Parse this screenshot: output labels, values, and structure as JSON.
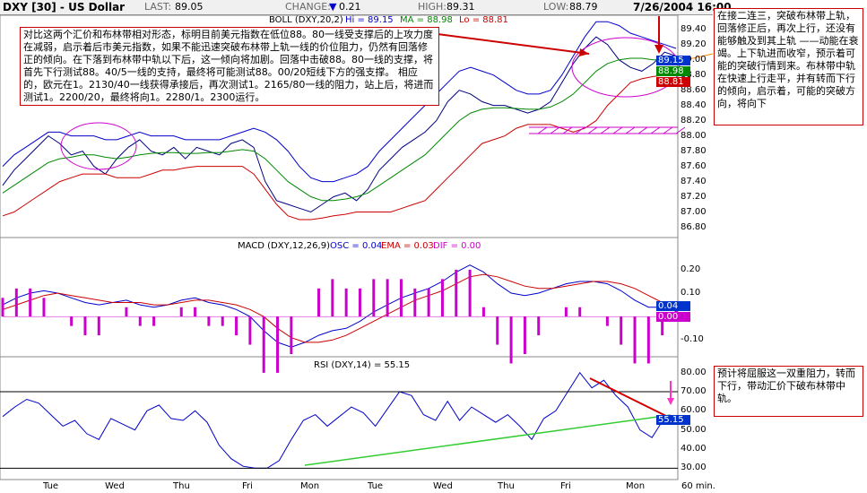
{
  "header": {
    "title": "DXY [30] - US Dollar",
    "last_label": "LAST:",
    "last": "89.05",
    "change_label": "CHANGE:",
    "change_arrow": "▼",
    "change": "0.21",
    "high_label": "HIGH:",
    "high": "89.31",
    "low_label": "LOW:",
    "low": "88.79",
    "datetime": "7/26/2004 16:00"
  },
  "price_panel": {
    "boll_title": "BOLL (DXY,20,2)",
    "boll_hi": "Hi = 89.15",
    "boll_ma": "MA = 88.98",
    "boll_lo": "Lo = 88.81",
    "tags": {
      "hi": "89.15",
      "ma": "88.98",
      "lo": "88.81"
    },
    "tag_colors": {
      "hi": "#0033cc",
      "ma": "#008800",
      "lo": "#cc0000"
    },
    "yticks": [
      "89.40",
      "89.20",
      "89.00",
      "88.80",
      "88.60",
      "88.40",
      "88.20",
      "88.00",
      "87.80",
      "87.60",
      "87.40",
      "87.20",
      "87.00",
      "86.80"
    ]
  },
  "macd_panel": {
    "title": "MACD (DXY,12,26,9)",
    "osc": "OSC = 0.04",
    "ema": "EMA = 0.03",
    "dif": "DIF = 0.00",
    "tag": "0.04",
    "tag2": "0.00",
    "yticks": [
      "0.20",
      "0.10",
      "-0.10"
    ]
  },
  "rsi_panel": {
    "title": "RSI (DXY,14) = 55.15",
    "tag": "55.15",
    "yticks": [
      "80.00",
      "70.00",
      "60.00",
      "50.00",
      "40.00",
      "30.00"
    ]
  },
  "xaxis": {
    "labels": [
      "Tue",
      "Wed",
      "Thu",
      "Fri",
      "Mon",
      "Tue",
      "Wed",
      "Thu",
      "Fri",
      "Mon"
    ],
    "unit": "60 min."
  },
  "annotations": {
    "left": "对比这两个汇价和布林带相对形态，标明目前美元指数在低位88。80一线受支撑后的上攻力度在减弱，启示着后市美元指数，如果不能迅速突破布林带上轨一线的价位阻力，仍然有回落修正的倾向。在下落到布林带中轨以下后，这一倾向将加剧。回落中击破88。80一线的支撑，将首先下行测试88。40/5一线的支持，最终将可能测试88。00/20短线下方的强支撑。 相应的，欧元在1。2130/40一线获得承接后，再次测试1。2165/80一线的阻力，站上后，将进而测试1。2200/20，最终将向1。2280/1。2300运行。",
    "right": "在接二连三，突破布林带上轨，回落修正后，再次上行，还没有能够触及到其上轨 ——动能在衰竭。上下轨进而收窄，预示着可能的突破行情到来。布林带中轨在快速上行走平，并有转而下行的倾向，启示着，可能的突破方向，将向下",
    "rsi": "预计将屈服这一双重阻力，转而下行，带动汇价下破布林带中轨。"
  },
  "chart_data": [
    {
      "type": "line",
      "title": "DXY [30] - US Dollar",
      "ylim": [
        86.7,
        89.55
      ],
      "series": [
        {
          "name": "Close",
          "color": "#000080",
          "values": [
            87.35,
            87.55,
            87.7,
            87.85,
            88.0,
            87.9,
            87.75,
            87.8,
            87.6,
            87.5,
            87.7,
            87.85,
            87.95,
            87.8,
            87.75,
            87.85,
            87.7,
            87.85,
            87.8,
            87.75,
            87.9,
            87.95,
            87.85,
            87.4,
            87.15,
            87.1,
            87.05,
            87.0,
            87.1,
            87.2,
            87.25,
            87.15,
            87.3,
            87.55,
            87.7,
            87.85,
            87.95,
            88.05,
            88.2,
            88.45,
            88.6,
            88.55,
            88.45,
            88.4,
            88.4,
            88.35,
            88.3,
            88.35,
            88.45,
            88.7,
            88.95,
            89.15,
            89.3,
            89.2,
            89.0,
            88.9,
            88.85,
            88.95,
            89.1,
            89.05
          ]
        },
        {
          "name": "BOLL Hi",
          "color": "#0000cc",
          "values": [
            87.6,
            87.75,
            87.85,
            87.95,
            88.05,
            88.05,
            88.0,
            88.0,
            88.0,
            87.95,
            87.95,
            88.0,
            88.05,
            88.0,
            88.0,
            88.0,
            87.95,
            87.95,
            87.95,
            87.95,
            88.0,
            88.05,
            88.1,
            88.05,
            87.95,
            87.8,
            87.6,
            87.45,
            87.4,
            87.4,
            87.45,
            87.5,
            87.6,
            87.8,
            87.95,
            88.1,
            88.25,
            88.4,
            88.55,
            88.7,
            88.85,
            88.9,
            88.85,
            88.8,
            88.7,
            88.6,
            88.55,
            88.55,
            88.6,
            88.8,
            89.05,
            89.3,
            89.5,
            89.5,
            89.45,
            89.35,
            89.3,
            89.25,
            89.2,
            89.15
          ]
        },
        {
          "name": "BOLL MA",
          "color": "#008800",
          "values": [
            87.25,
            87.35,
            87.45,
            87.55,
            87.65,
            87.7,
            87.72,
            87.75,
            87.75,
            87.72,
            87.7,
            87.72,
            87.75,
            87.77,
            87.78,
            87.78,
            87.77,
            87.77,
            87.78,
            87.78,
            87.8,
            87.82,
            87.8,
            87.7,
            87.55,
            87.4,
            87.3,
            87.2,
            87.15,
            87.15,
            87.17,
            87.2,
            87.25,
            87.35,
            87.45,
            87.55,
            87.65,
            87.75,
            87.9,
            88.05,
            88.2,
            88.3,
            88.35,
            88.37,
            88.37,
            88.36,
            88.35,
            88.35,
            88.38,
            88.45,
            88.55,
            88.7,
            88.85,
            88.95,
            89.0,
            89.02,
            89.02,
            89.0,
            89.0,
            88.98
          ]
        },
        {
          "name": "BOLL Lo",
          "color": "#cc0000",
          "values": [
            86.95,
            87.0,
            87.1,
            87.2,
            87.3,
            87.4,
            87.45,
            87.5,
            87.5,
            87.5,
            87.45,
            87.45,
            87.45,
            87.5,
            87.55,
            87.55,
            87.58,
            87.6,
            87.6,
            87.6,
            87.6,
            87.6,
            87.5,
            87.3,
            87.1,
            86.95,
            86.9,
            86.9,
            86.92,
            86.95,
            86.97,
            87.0,
            87.0,
            87.0,
            87.0,
            87.05,
            87.1,
            87.15,
            87.3,
            87.45,
            87.6,
            87.75,
            87.9,
            87.95,
            88.0,
            88.1,
            88.15,
            88.15,
            88.15,
            88.1,
            88.05,
            88.1,
            88.2,
            88.4,
            88.55,
            88.7,
            88.75,
            88.78,
            88.8,
            88.81
          ]
        }
      ]
    },
    {
      "type": "line",
      "title": "MACD (DXY,12,26,9)",
      "ylim": [
        -0.16,
        0.28
      ],
      "series": [
        {
          "name": "DIF",
          "color": "#0000cc",
          "values": [
            0.05,
            0.08,
            0.1,
            0.11,
            0.1,
            0.08,
            0.06,
            0.05,
            0.06,
            0.07,
            0.05,
            0.04,
            0.05,
            0.07,
            0.08,
            0.06,
            0.05,
            0.03,
            0.0,
            -0.06,
            -0.11,
            -0.13,
            -0.11,
            -0.08,
            -0.06,
            -0.05,
            -0.02,
            0.02,
            0.05,
            0.08,
            0.1,
            0.12,
            0.15,
            0.19,
            0.22,
            0.19,
            0.14,
            0.1,
            0.09,
            0.1,
            0.12,
            0.14,
            0.15,
            0.15,
            0.14,
            0.11,
            0.07,
            0.04,
            0.04,
            0.04
          ]
        },
        {
          "name": "EMA",
          "color": "#cc0000",
          "values": [
            0.03,
            0.05,
            0.07,
            0.09,
            0.1,
            0.09,
            0.08,
            0.07,
            0.06,
            0.06,
            0.06,
            0.05,
            0.05,
            0.06,
            0.07,
            0.07,
            0.06,
            0.05,
            0.03,
            0.0,
            -0.05,
            -0.09,
            -0.11,
            -0.11,
            -0.1,
            -0.08,
            -0.05,
            -0.02,
            0.01,
            0.04,
            0.07,
            0.09,
            0.11,
            0.14,
            0.17,
            0.18,
            0.17,
            0.15,
            0.13,
            0.12,
            0.12,
            0.13,
            0.14,
            0.15,
            0.15,
            0.14,
            0.12,
            0.09,
            0.06,
            0.03
          ]
        }
      ]
    },
    {
      "type": "line",
      "title": "RSI (DXY,14) = 55.15",
      "ylim": [
        25,
        85
      ],
      "series": [
        {
          "name": "RSI",
          "color": "#0000cc",
          "values": [
            57,
            62,
            66,
            64,
            58,
            52,
            55,
            48,
            45,
            56,
            53,
            50,
            60,
            63,
            56,
            55,
            60,
            54,
            42,
            35,
            31,
            30,
            30,
            34,
            45,
            55,
            58,
            52,
            57,
            62,
            59,
            52,
            61,
            70,
            68,
            58,
            55,
            65,
            55,
            62,
            58,
            54,
            58,
            52,
            45,
            56,
            60,
            70,
            80,
            72,
            76,
            68,
            62,
            50,
            46,
            56,
            55
          ]
        }
      ]
    }
  ]
}
